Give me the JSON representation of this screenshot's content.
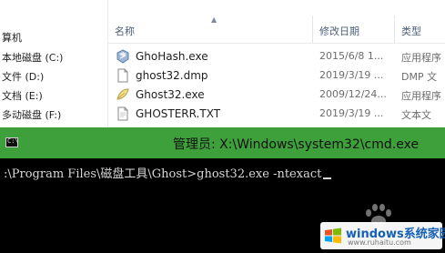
{
  "navigation": {
    "items": [
      {
        "label": "算机"
      },
      {
        "label": "本地磁盘 (C:)"
      },
      {
        "label": "文件 (D:)"
      },
      {
        "label": "文档 (E:)"
      },
      {
        "label": "多动磁盘 (F:)"
      }
    ]
  },
  "columns": {
    "name": "名称",
    "date": "修改日期",
    "type": "类型"
  },
  "files": [
    {
      "name": "GhoHash.exe",
      "date": "2015/6/8 1...",
      "type": "应用程序",
      "icon": "exe-icon"
    },
    {
      "name": "ghost32.dmp",
      "date": "2019/3/19 ...",
      "type": "DMP 文",
      "icon": "document-icon"
    },
    {
      "name": "Ghost32.exe",
      "date": "2009/12/24...",
      "type": "应用程序",
      "icon": "ghost-app-icon"
    },
    {
      "name": "GHOSTERR.TXT",
      "date": "2019/3/19 ...",
      "type": "文本文",
      "icon": "document-icon"
    }
  ],
  "cmd": {
    "title": "管理员: X:\\Windows\\system32\\cmd.exe",
    "icon_text": "C:\\",
    "command_line": ":\\Program Files\\磁盘工具\\Ghost>ghost32.exe -ntexact",
    "titlebar_color": "#3ea03a"
  },
  "watermark": {
    "brand": "windows系统家园",
    "url": "www.ruhaitu.com"
  }
}
